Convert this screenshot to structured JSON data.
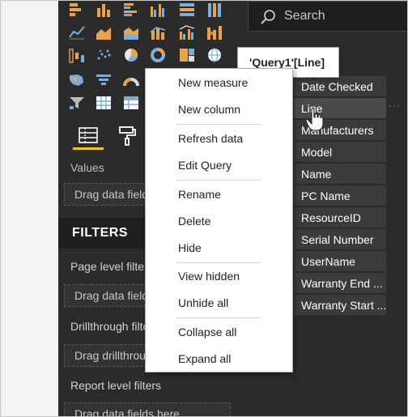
{
  "search": {
    "placeholder": "Search",
    "icon": "search-icon"
  },
  "visualizations": {
    "tabs": [
      {
        "icon": "fields-icon",
        "active": true
      },
      {
        "icon": "paint-roller-icon",
        "active": false
      }
    ]
  },
  "values_section": {
    "label": "Values",
    "well_text": "Drag data fields here"
  },
  "filters": {
    "title": "FILTERS",
    "page_level_label": "Page level filters",
    "page_well": "Drag data fields here",
    "drillthrough_label": "Drillthrough filters",
    "drillthrough_well": "Drag drillthrough fields here",
    "report_level_label": "Report level filters",
    "report_well": "Drag data fields here"
  },
  "fields": [
    "Date Checked",
    "Line",
    "Manufacturers",
    "Model",
    "Name",
    "PC Name",
    "ResourceID",
    "Serial Number",
    "UserName",
    "Warranty End ...",
    "Warranty Start ..."
  ],
  "tooltip": {
    "text": "'Query1'[Line]"
  },
  "context_menu": {
    "items": [
      "New measure",
      "New column",
      "Refresh data",
      "Edit Query",
      "Rename",
      "Delete",
      "Hide",
      "View hidden",
      "Unhide all",
      "Collapse all",
      "Expand all"
    ]
  },
  "colors": {
    "panel_bg": "#2b2b2b",
    "accent_yellow": "#f2c811",
    "viz_orange": "#e8a34b",
    "viz_blue": "#7aaede"
  }
}
